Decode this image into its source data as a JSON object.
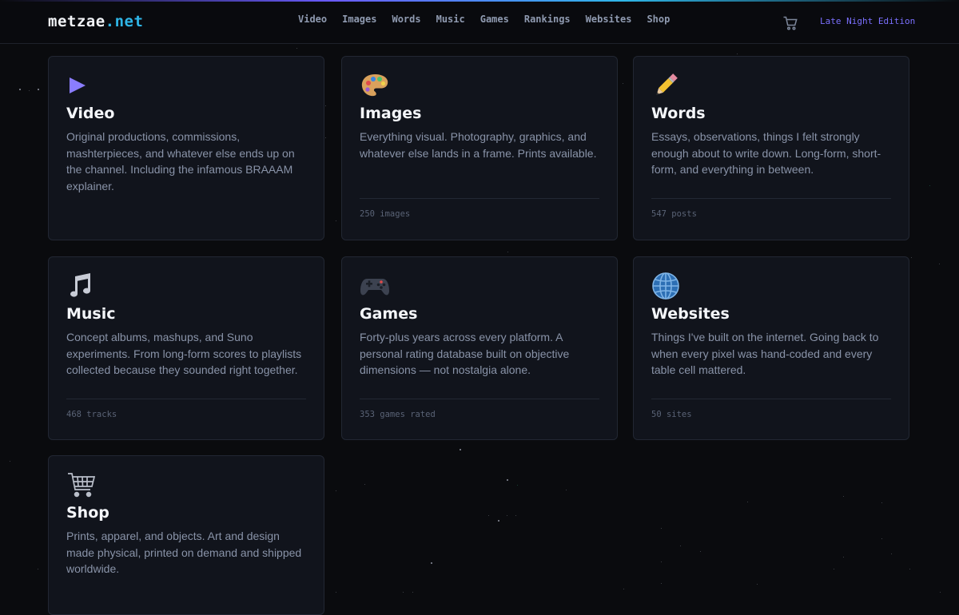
{
  "header": {
    "logo_main": "metzae",
    "logo_tld": ".net",
    "nav": [
      "Video",
      "Images",
      "Words",
      "Music",
      "Games",
      "Rankings",
      "Websites",
      "Shop"
    ],
    "edition": "Late Night Edition"
  },
  "cards": [
    {
      "icon": "play-icon",
      "title": "Video",
      "desc": "Original productions, commissions, mashterpieces, and whatever else ends up on the channel. Including the infamous BRAAAM explainer.",
      "meta": ""
    },
    {
      "icon": "palette-icon",
      "title": "Images",
      "desc": "Everything visual. Photography, graphics, and whatever else lands in a frame. Prints available.",
      "meta": "250 images"
    },
    {
      "icon": "pencil-icon",
      "title": "Words",
      "desc": "Essays, observations, things I felt strongly enough about to write down. Long-form, short-form, and everything in between.",
      "meta": "547 posts"
    },
    {
      "icon": "music-note-icon",
      "title": "Music",
      "desc": "Concept albums, mashups, and Suno experiments. From long-form scores to playlists collected because they sounded right together.",
      "meta": "468 tracks"
    },
    {
      "icon": "gamepad-icon",
      "title": "Games",
      "desc": "Forty-plus years across every platform. A personal rating database built on objective dimensions — not nostalgia alone.",
      "meta": "353 games rated"
    },
    {
      "icon": "globe-icon",
      "title": "Websites",
      "desc": "Things I've built on the internet. Going back to when every pixel was hand-coded and every table cell mattered.",
      "meta": "50 sites"
    },
    {
      "icon": "shopping-cart-icon",
      "title": "Shop",
      "desc": "Prints, apparel, and objects. Art and design made physical, printed on demand and shipped worldwide.",
      "meta": ""
    }
  ],
  "colors": {
    "accent_cyan": "#2fb6e8",
    "accent_violet": "#7b70ff",
    "card_bg": "#11141c",
    "page_bg": "#0a0b0e"
  }
}
